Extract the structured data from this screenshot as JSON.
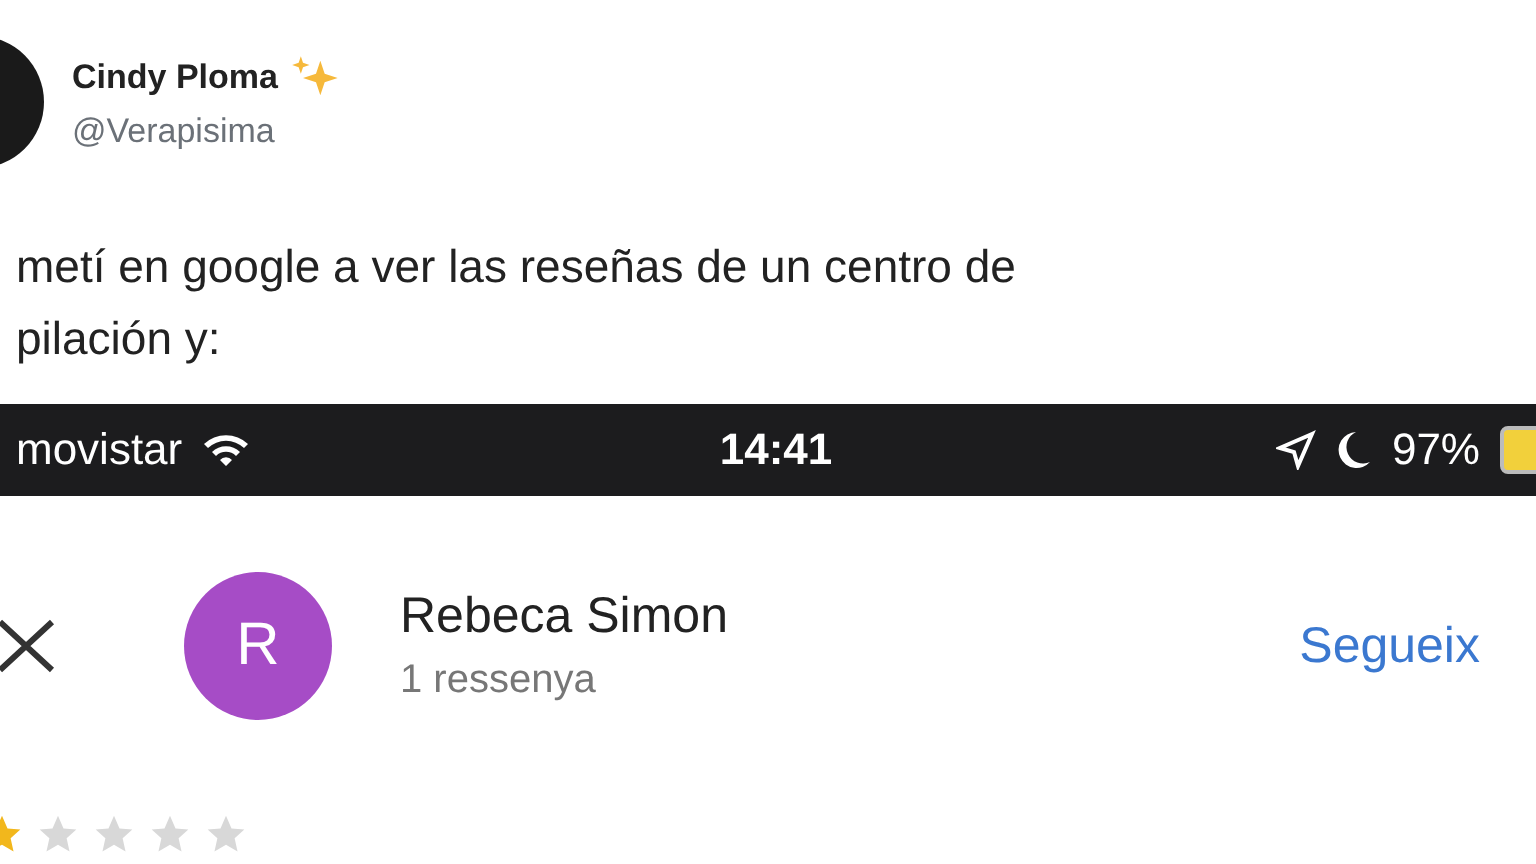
{
  "tweet": {
    "author": "Cindy Ploma",
    "handle": "@Verapisima",
    "text_lines": [
      "metí en google a ver las reseñas de un centro de",
      "pilación y:"
    ]
  },
  "embedded_screenshot": {
    "status_bar": {
      "carrier": "movistar",
      "time": "14:41",
      "battery": "97%"
    },
    "reviewer": {
      "initial": "R",
      "name": "Rebeca Simon",
      "review_count": "1 ressenya",
      "follow": "Segueix"
    },
    "review": {
      "stars": 1
    }
  }
}
